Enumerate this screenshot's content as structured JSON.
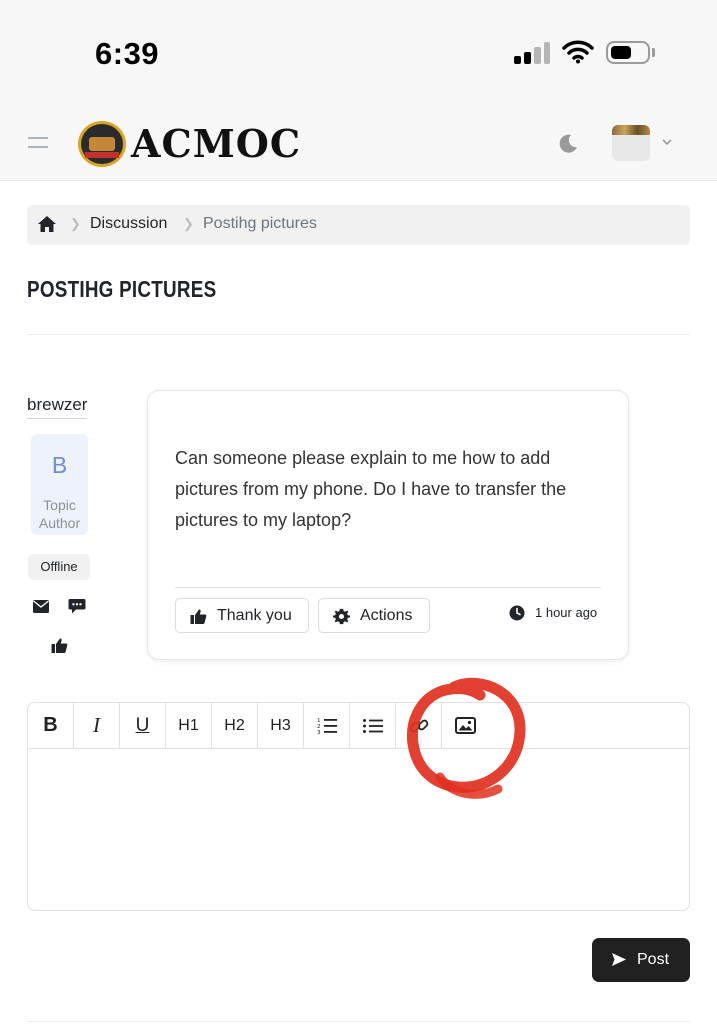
{
  "status_bar": {
    "time": "6:39"
  },
  "header": {
    "site_name": "ACMOC"
  },
  "breadcrumb": {
    "items": [
      "Discussion",
      "Postihg pictures"
    ]
  },
  "page": {
    "title": "POSTIHG PICTURES"
  },
  "author": {
    "name": "brewzer",
    "avatar_letter": "B",
    "role": "Topic Author",
    "status": "Offline"
  },
  "post": {
    "text": "Can someone please explain to me how to add pictures from my phone. Do I have to transfer the pictures to my laptop?",
    "thank_label": "Thank you",
    "actions_label": "Actions",
    "time": "1 hour ago"
  },
  "editor": {
    "toolbar": [
      "B",
      "I",
      "U",
      "H1",
      "H2",
      "H3",
      "ordered-list-icon",
      "bullet-list-icon",
      "link-icon",
      "image-icon"
    ],
    "h1": "H1",
    "h2": "H2",
    "h3": "H3"
  },
  "submit": {
    "label": "Post"
  },
  "colors": {
    "annotation": "#e0301e",
    "button_dark": "#212121"
  }
}
